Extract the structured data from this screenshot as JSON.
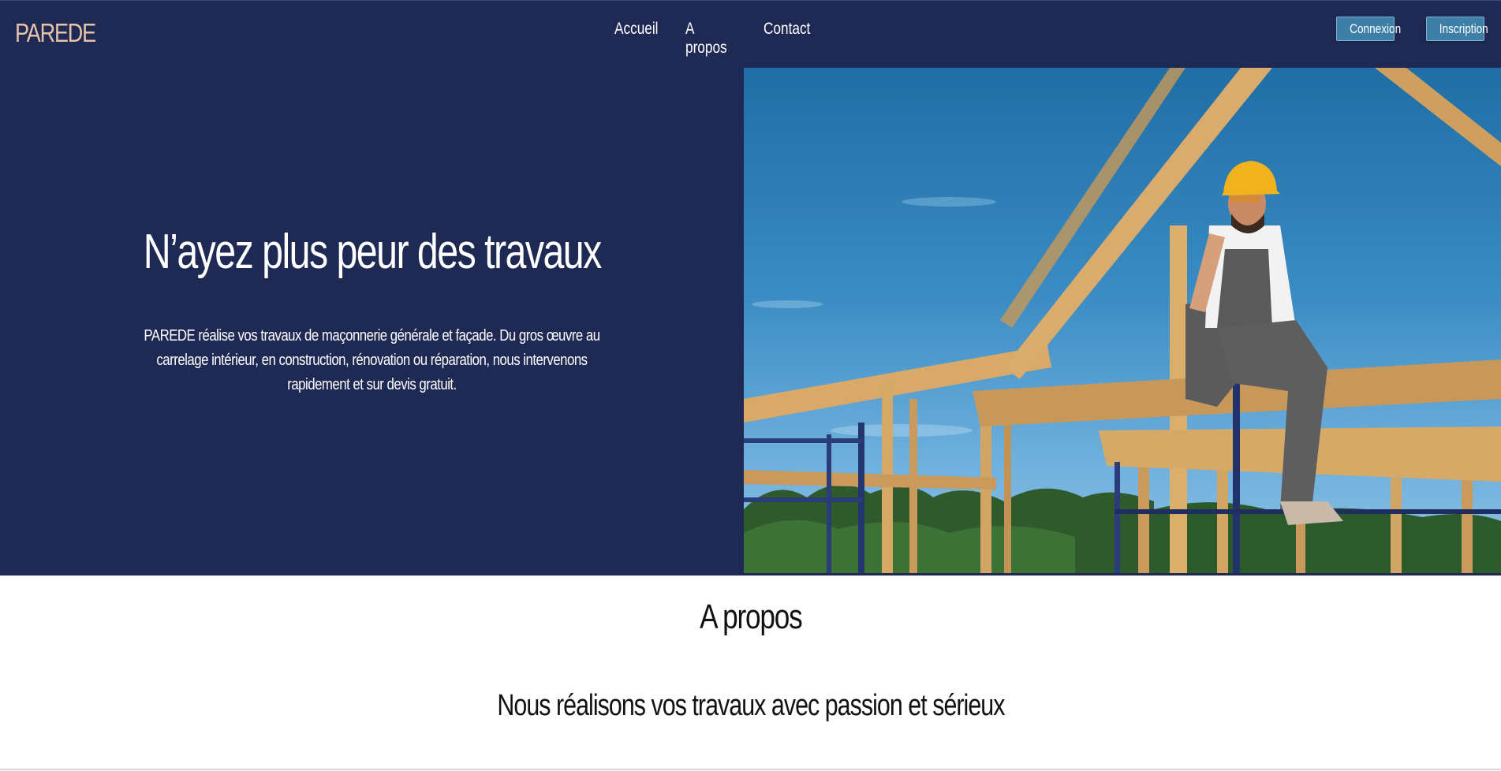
{
  "navbar": {
    "brand": "PAREDE",
    "links": [
      "Accueil",
      "A propos",
      "Contact"
    ],
    "login_label": "Connexion",
    "signup_label": "Inscription"
  },
  "hero": {
    "title": "N’ayez plus peur des travaux",
    "text": "PAREDE réalise vos travaux de maçonnerie générale et façade. Du gros œuvre au carrelage intérieur, en construction, rénovation ou réparation, nous intervenons rapidement et sur devis gratuit."
  },
  "about": {
    "title": "A propos",
    "subtitle": "Nous réalisons vos travaux avec passion et sérieux"
  },
  "colors": {
    "nav_bg": "#1f2a54",
    "brand": "#e6c2a8",
    "button": "#3e7fa8"
  }
}
